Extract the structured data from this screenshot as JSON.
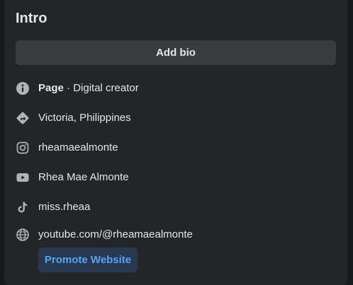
{
  "intro": {
    "title": "Intro",
    "add_bio_label": "Add bio"
  },
  "details": {
    "category_prefix": "Page",
    "category_separator": " · ",
    "category": "Digital creator",
    "location": "Victoria, Philippines",
    "instagram": "rheamaealmonte",
    "youtube": "Rhea Mae Almonte",
    "tiktok": "miss.rheaa",
    "website": "youtube.com/@rheamaealmonte"
  },
  "actions": {
    "promote_label": "Promote Website"
  },
  "icons": {
    "info": "info-icon",
    "location": "directions-icon",
    "instagram": "instagram-icon",
    "youtube": "youtube-icon",
    "tiktok": "tiktok-icon",
    "website": "globe-icon"
  },
  "colors": {
    "background": "#18191a",
    "card": "#242526",
    "button": "#3a3b3c",
    "link": "#4e9af0",
    "promote_bg": "#263951"
  }
}
